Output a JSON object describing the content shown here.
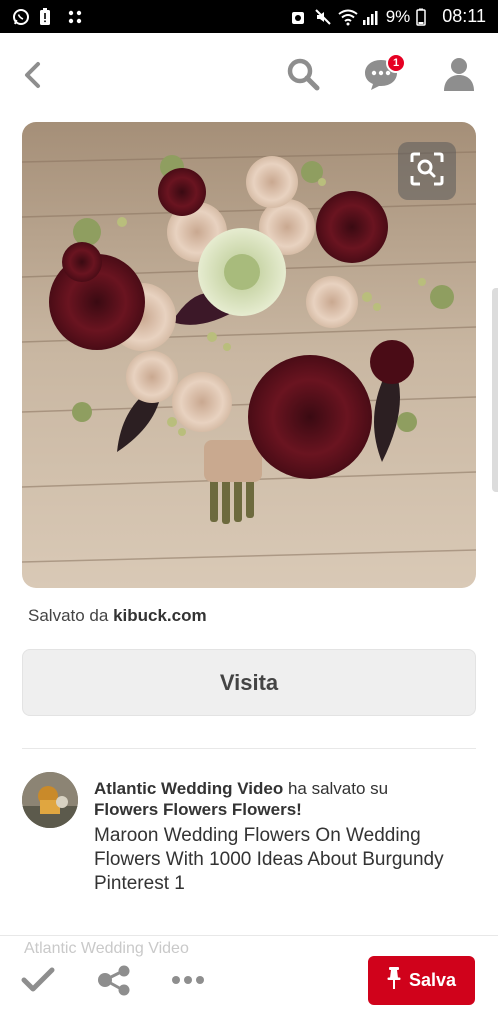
{
  "status_bar": {
    "battery": "9%",
    "time": "08:11",
    "left_icons": [
      "whatsapp-icon",
      "battery-alert-icon",
      "dots-grid-icon"
    ],
    "right_icons": [
      "alarm-icon",
      "mute-icon",
      "wifi-icon",
      "signal-icon"
    ]
  },
  "nav": {
    "notification_count": "1",
    "icons": [
      "back-arrow-icon",
      "search-icon",
      "chat-icon",
      "profile-icon"
    ]
  },
  "pin": {
    "image_alt": "bouquet",
    "saved_prefix": "Salvato da ",
    "saved_source": "kibuck.com",
    "visit_label": "Visita"
  },
  "pinner": {
    "name": "Atlantic Wedding Video",
    "action": " ha salvato su",
    "board": "Flowers Flowers Flowers!",
    "description": "Maroon Wedding Flowers On Wedding Flowers With 1000 Ideas About Burgundy Pinterest 1"
  },
  "bottom_bar": {
    "save_label": "Salva",
    "ghost_text": "Atlantic Wedding Video",
    "icons": [
      "check-icon",
      "share-icon",
      "more-icon",
      "pin-icon"
    ]
  },
  "colors": {
    "accent": "#e60023",
    "save_button": "#d0021b",
    "icon_gray": "#8e8e8e"
  }
}
